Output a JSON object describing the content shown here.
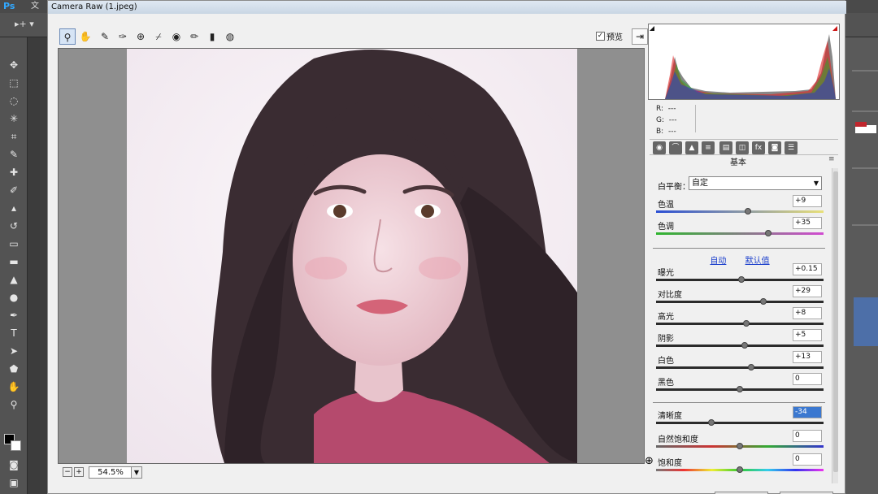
{
  "ps": {
    "logo": "Ps",
    "menu_first": "文",
    "zoom_field_hint": "1"
  },
  "dialog": {
    "title": "Camera Raw (1.jpeg)",
    "preview_label": "预览",
    "preview_checked": true,
    "zoom_value": "54.5%"
  },
  "panel": {
    "rgb": {
      "r_label": "R:",
      "r_value": "---",
      "g_label": "G:",
      "g_value": "---",
      "b_label": "B:",
      "b_value": "---"
    },
    "section_title": "基本",
    "white_balance": {
      "label": "白平衡：",
      "selected": "自定"
    },
    "auto_label": "自动",
    "default_label": "默认值",
    "sliders": [
      {
        "label": "色温",
        "value": "+9",
        "position": 0.55
      },
      {
        "label": "色调",
        "value": "+35",
        "position": 0.67
      },
      {
        "label": "曝光",
        "value": "+0.15",
        "position": 0.51
      },
      {
        "label": "对比度",
        "value": "+29",
        "position": 0.64
      },
      {
        "label": "高光",
        "value": "+8",
        "position": 0.54
      },
      {
        "label": "阴影",
        "value": "+5",
        "position": 0.53
      },
      {
        "label": "白色",
        "value": "+13",
        "position": 0.57
      },
      {
        "label": "黑色",
        "value": "0",
        "position": 0.5
      },
      {
        "label": "清晰度",
        "value": "-34",
        "position": 0.33,
        "selected": true
      },
      {
        "label": "自然饱和度",
        "value": "0",
        "position": 0.5
      },
      {
        "label": "饱和度",
        "value": "0",
        "position": 0.5
      }
    ]
  },
  "colors": {
    "accent": "#3b78d0",
    "link": "#1a3ecc"
  }
}
